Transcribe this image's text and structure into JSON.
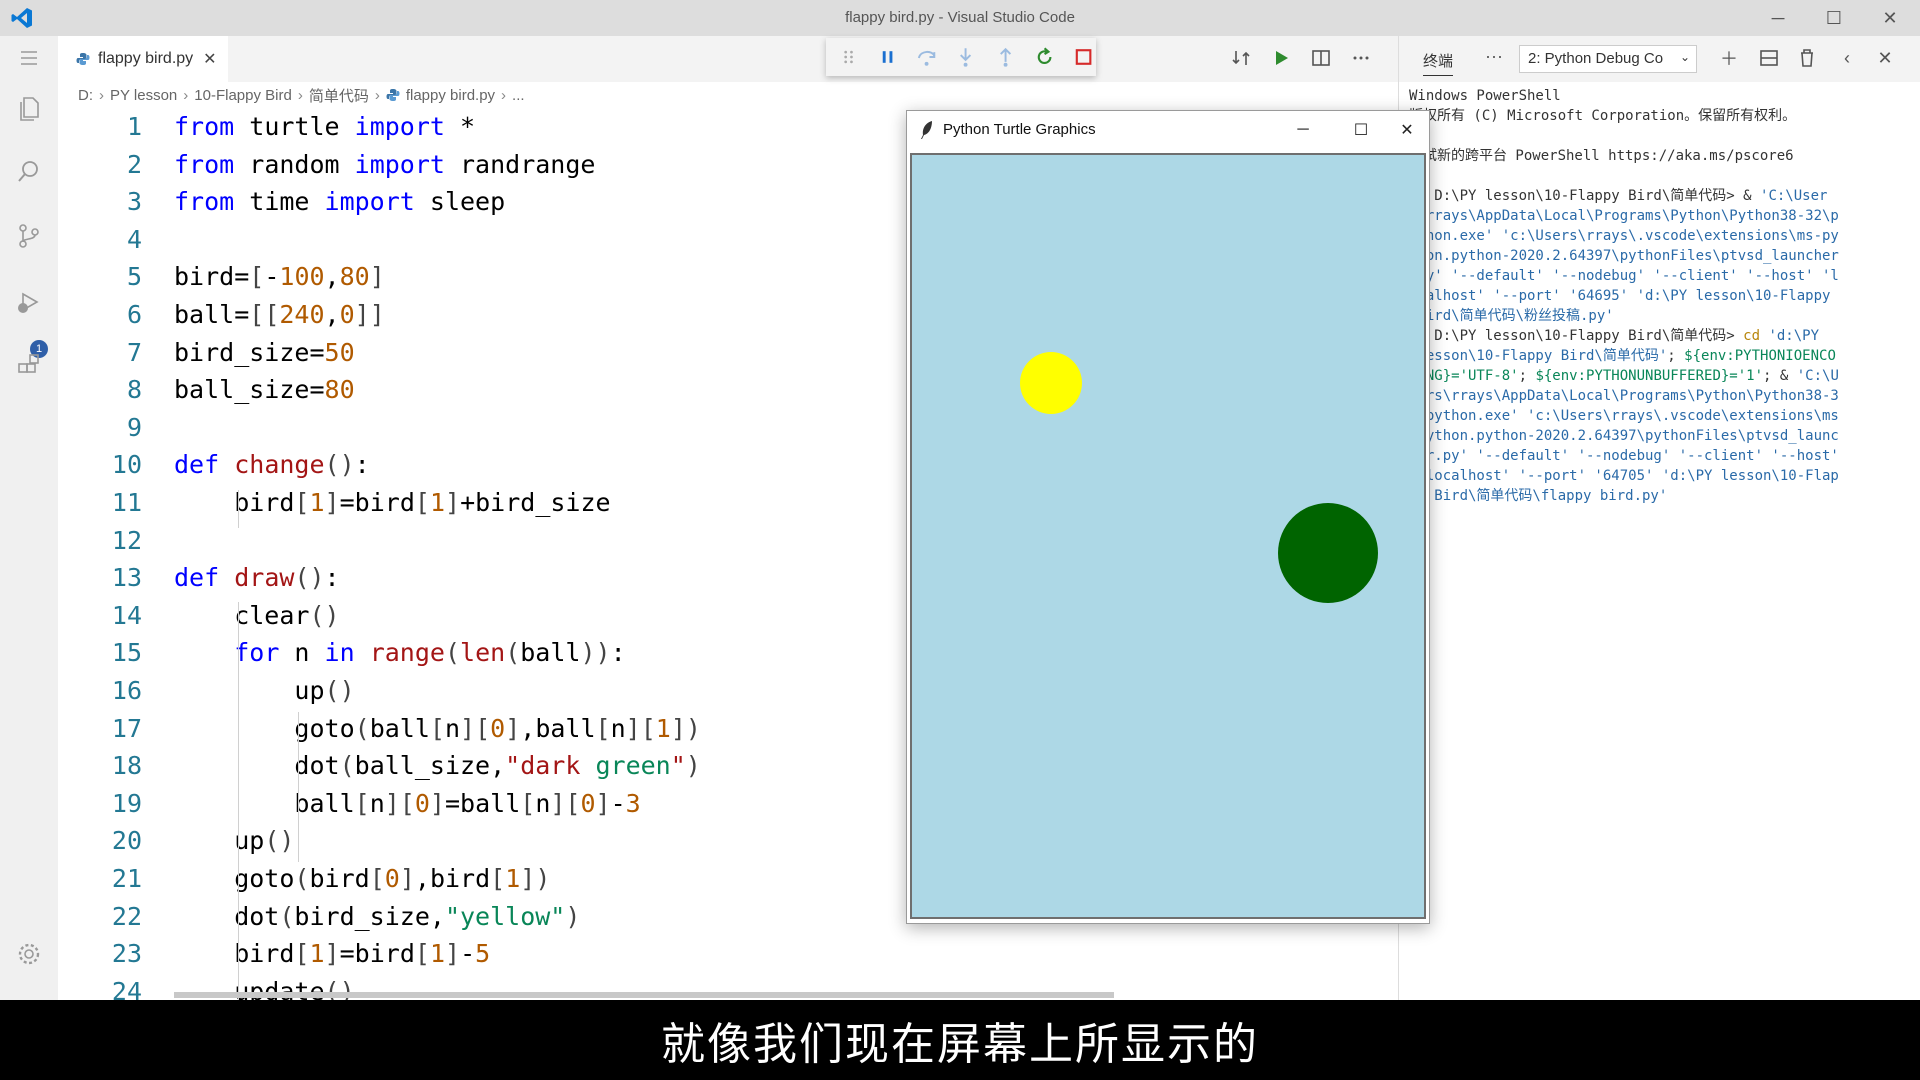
{
  "window": {
    "title": "flappy bird.py - Visual Studio Code",
    "minimize": "─",
    "maximize": "☐",
    "close": "✕"
  },
  "activity": {
    "debug_badge": "1"
  },
  "editor": {
    "tab_label": "flappy bird.py",
    "tab_close": "✕",
    "breadcrumb": [
      "D:",
      "PY lesson",
      "10-Flappy Bird",
      "简单代码",
      "flappy bird.py",
      "..."
    ],
    "lines": [
      {
        "n": "1",
        "tokens": [
          [
            "kw",
            "from"
          ],
          [
            "t",
            " turtle "
          ],
          [
            "kw",
            "import"
          ],
          [
            "t",
            " *"
          ]
        ]
      },
      {
        "n": "2",
        "tokens": [
          [
            "kw",
            "from"
          ],
          [
            "t",
            " random "
          ],
          [
            "kw",
            "import"
          ],
          [
            "t",
            " randrange"
          ]
        ]
      },
      {
        "n": "3",
        "tokens": [
          [
            "kw",
            "from"
          ],
          [
            "t",
            " time "
          ],
          [
            "kw",
            "import"
          ],
          [
            "t",
            " sleep"
          ]
        ]
      },
      {
        "n": "4",
        "tokens": []
      },
      {
        "n": "5",
        "tokens": [
          [
            "t",
            "bird="
          ],
          [
            "br",
            "["
          ],
          [
            "t",
            "-"
          ],
          [
            "num",
            "100"
          ],
          [
            "t",
            ","
          ],
          [
            "num",
            "80"
          ],
          [
            "br",
            "]"
          ]
        ]
      },
      {
        "n": "6",
        "tokens": [
          [
            "t",
            "ball="
          ],
          [
            "br",
            "[["
          ],
          [
            "num",
            "240"
          ],
          [
            "t",
            ","
          ],
          [
            "num",
            "0"
          ],
          [
            "br",
            "]]"
          ]
        ]
      },
      {
        "n": "7",
        "tokens": [
          [
            "t",
            "bird_size="
          ],
          [
            "num",
            "50"
          ]
        ]
      },
      {
        "n": "8",
        "tokens": [
          [
            "t",
            "ball_size="
          ],
          [
            "num",
            "80"
          ]
        ]
      },
      {
        "n": "9",
        "tokens": []
      },
      {
        "n": "10",
        "tokens": [
          [
            "kw",
            "def"
          ],
          [
            "t",
            " "
          ],
          [
            "fn",
            "change"
          ],
          [
            "br",
            "()"
          ],
          [
            "t",
            ":"
          ]
        ]
      },
      {
        "n": "11",
        "tokens": [
          [
            "t",
            "    bird"
          ],
          [
            "br",
            "["
          ],
          [
            "num",
            "1"
          ],
          [
            "br",
            "]"
          ],
          [
            "t",
            "=bird"
          ],
          [
            "br",
            "["
          ],
          [
            "num",
            "1"
          ],
          [
            "br",
            "]"
          ],
          [
            "t",
            "+bird_size"
          ]
        ]
      },
      {
        "n": "12",
        "tokens": []
      },
      {
        "n": "13",
        "tokens": [
          [
            "kw",
            "def"
          ],
          [
            "t",
            " "
          ],
          [
            "fn",
            "draw"
          ],
          [
            "br",
            "()"
          ],
          [
            "t",
            ":"
          ]
        ]
      },
      {
        "n": "14",
        "tokens": [
          [
            "t",
            "    clear"
          ],
          [
            "br",
            "()"
          ]
        ]
      },
      {
        "n": "15",
        "tokens": [
          [
            "t",
            "    "
          ],
          [
            "kw",
            "for"
          ],
          [
            "t",
            " n "
          ],
          [
            "kw",
            "in"
          ],
          [
            "t",
            " "
          ],
          [
            "fn",
            "range"
          ],
          [
            "br",
            "("
          ],
          [
            "fn",
            "len"
          ],
          [
            "br",
            "("
          ],
          [
            "t",
            "ball"
          ],
          [
            "br",
            "))"
          ],
          [
            "t",
            ":"
          ]
        ]
      },
      {
        "n": "16",
        "tokens": [
          [
            "t",
            "        up"
          ],
          [
            "br",
            "()"
          ]
        ]
      },
      {
        "n": "17",
        "tokens": [
          [
            "t",
            "        goto"
          ],
          [
            "br",
            "("
          ],
          [
            "t",
            "ball"
          ],
          [
            "br",
            "["
          ],
          [
            "t",
            "n"
          ],
          [
            "br",
            "]["
          ],
          [
            "num",
            "0"
          ],
          [
            "br",
            "]"
          ],
          [
            "t",
            ",ball"
          ],
          [
            "br",
            "["
          ],
          [
            "t",
            "n"
          ],
          [
            "br",
            "]["
          ],
          [
            "num",
            "1"
          ],
          [
            "br",
            "])"
          ]
        ]
      },
      {
        "n": "18",
        "tokens": [
          [
            "t",
            "        dot"
          ],
          [
            "br",
            "("
          ],
          [
            "t",
            "ball_size,"
          ],
          [
            "str",
            "\"dark "
          ],
          [
            "strg",
            "green"
          ],
          [
            "str",
            "\""
          ],
          [
            "br",
            ")"
          ]
        ]
      },
      {
        "n": "19",
        "tokens": [
          [
            "t",
            "        ball"
          ],
          [
            "br",
            "["
          ],
          [
            "t",
            "n"
          ],
          [
            "br",
            "]["
          ],
          [
            "num",
            "0"
          ],
          [
            "br",
            "]"
          ],
          [
            "t",
            "=ball"
          ],
          [
            "br",
            "["
          ],
          [
            "t",
            "n"
          ],
          [
            "br",
            "]["
          ],
          [
            "num",
            "0"
          ],
          [
            "br",
            "]"
          ],
          [
            "t",
            "-"
          ],
          [
            "num",
            "3"
          ]
        ]
      },
      {
        "n": "20",
        "tokens": [
          [
            "t",
            "    up"
          ],
          [
            "br",
            "()"
          ]
        ]
      },
      {
        "n": "21",
        "tokens": [
          [
            "t",
            "    goto"
          ],
          [
            "br",
            "("
          ],
          [
            "t",
            "bird"
          ],
          [
            "br",
            "["
          ],
          [
            "num",
            "0"
          ],
          [
            "br",
            "]"
          ],
          [
            "t",
            ",bird"
          ],
          [
            "br",
            "["
          ],
          [
            "num",
            "1"
          ],
          [
            "br",
            "])"
          ]
        ]
      },
      {
        "n": "22",
        "tokens": [
          [
            "t",
            "    dot"
          ],
          [
            "br",
            "("
          ],
          [
            "t",
            "bird_size,"
          ],
          [
            "strg",
            "\"yellow\""
          ],
          [
            "br",
            ")"
          ]
        ]
      },
      {
        "n": "23",
        "tokens": [
          [
            "t",
            "    bird"
          ],
          [
            "br",
            "["
          ],
          [
            "num",
            "1"
          ],
          [
            "br",
            "]"
          ],
          [
            "t",
            "=bird"
          ],
          [
            "br",
            "["
          ],
          [
            "num",
            "1"
          ],
          [
            "br",
            "]"
          ],
          [
            "t",
            "-"
          ],
          [
            "num",
            "5"
          ]
        ]
      },
      {
        "n": "24",
        "tokens": [
          [
            "t",
            "    update"
          ],
          [
            "br",
            "()"
          ]
        ]
      }
    ]
  },
  "panel": {
    "tab_label": "终端",
    "more": "···",
    "select_value": "2: Python Debug Co",
    "terminal_lines": [
      [
        [
          "t",
          "Windows PowerShell"
        ]
      ],
      [
        [
          "t",
          "版权所有 (C) Microsoft Corporation。保留所有权利。"
        ]
      ],
      [
        [
          "t",
          ""
        ]
      ],
      [
        [
          "t",
          "尝试新的跨平台 PowerShell https://aka.ms/pscore6"
        ]
      ],
      [
        [
          "t",
          ""
        ]
      ],
      [
        [
          "t",
          "PS D:\\PY lesson\\10-Flappy Bird\\简单代码> & "
        ],
        [
          "tblue",
          "'C:\\User"
        ]
      ],
      [
        [
          "tblue",
          "s\\rrays\\AppData\\Local\\Programs\\Python\\Python38-32\\p"
        ]
      ],
      [
        [
          "tblue",
          "ython.exe' 'c:\\Users\\rrays\\.vscode\\extensions\\ms-py"
        ]
      ],
      [
        [
          "tblue",
          "thon.python-2020.2.64397\\pythonFiles\\ptvsd_launcher"
        ]
      ],
      [
        [
          "tblue",
          ".py' '--default' '--nodebug' '--client' '--host' 'l"
        ]
      ],
      [
        [
          "tblue",
          "ocalhost' '--port' '64695' 'd:\\PY lesson\\10-Flappy"
        ]
      ],
      [
        [
          "tblue",
          " Bird\\简单代码\\粉丝投稿.py'"
        ]
      ],
      [
        [
          "t",
          "PS D:\\PY lesson\\10-Flappy Bird\\简单代码> "
        ],
        [
          "tyellow",
          "cd"
        ],
        [
          "tblue",
          " 'd:\\PY"
        ]
      ],
      [
        [
          "tblue",
          " lesson\\10-Flappy Bird\\简单代码'"
        ],
        [
          "t",
          "; "
        ],
        [
          "tgreen",
          "${env:PYTHONIOENCO"
        ]
      ],
      [
        [
          "tgreen",
          "DING}='UTF-8'"
        ],
        [
          "t",
          "; "
        ],
        [
          "tgreen",
          "${env:PYTHONUNBUFFERED}='1'"
        ],
        [
          "t",
          "; & "
        ],
        [
          "tblue",
          "'C:\\U"
        ]
      ],
      [
        [
          "tblue",
          "sers\\rrays\\AppData\\Local\\Programs\\Python\\Python38-3"
        ]
      ],
      [
        [
          "tblue",
          "2\\python.exe' 'c:\\Users\\rrays\\.vscode\\extensions\\ms"
        ]
      ],
      [
        [
          "tblue",
          "-python.python-2020.2.64397\\pythonFiles\\ptvsd_launc"
        ]
      ],
      [
        [
          "tblue",
          "her.py' '--default' '--nodebug' '--client' '--host'"
        ]
      ],
      [
        [
          "tblue",
          " 'localhost' '--port' '64705' 'd:\\PY lesson\\10-Flap"
        ]
      ],
      [
        [
          "tblue",
          "py Bird\\简单代码\\flappy bird.py'"
        ]
      ]
    ]
  },
  "turtle": {
    "title": "Python Turtle Graphics",
    "background": "#add8e6",
    "bird_color": "#ffff00",
    "ball_color": "#006400"
  },
  "subtitle": "就像我们现在屏幕上所显示的",
  "colors": {
    "accent": "#007acc"
  }
}
